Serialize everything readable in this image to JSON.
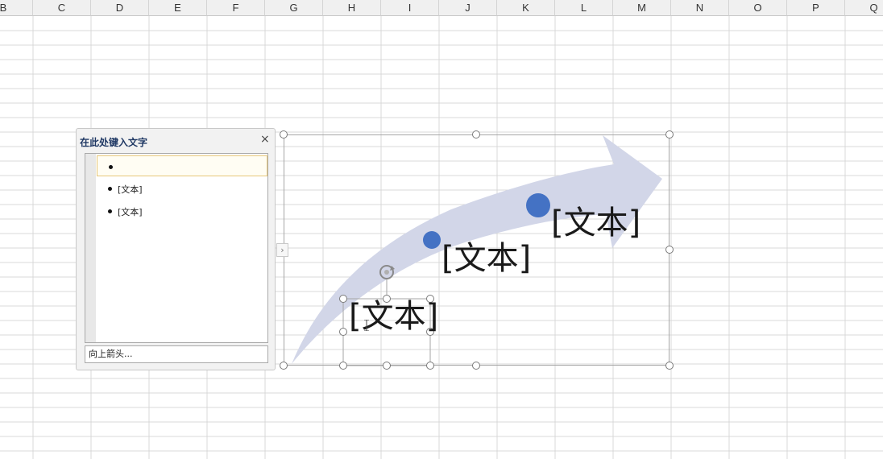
{
  "sheet": {
    "columns": [
      "B",
      "C",
      "D",
      "E",
      "F",
      "G",
      "H",
      "I",
      "J",
      "K",
      "L",
      "M",
      "N",
      "O",
      "P",
      "Q"
    ]
  },
  "smartart": {
    "items": [
      {
        "label": "[文本]"
      },
      {
        "label": "[文本]"
      },
      {
        "label": "[文本]"
      }
    ],
    "colors": {
      "arrow": "#d2d6e8",
      "dot": "#4472c4",
      "frame": "#a6a6a6"
    }
  },
  "text_pane": {
    "title": "在此处键入文字",
    "close_glyph": "×",
    "bullets": [
      {
        "label": ""
      },
      {
        "label": "[文本]"
      },
      {
        "label": "[文本]"
      }
    ],
    "footer": "向上箭头...",
    "toggle_glyph": "›"
  }
}
